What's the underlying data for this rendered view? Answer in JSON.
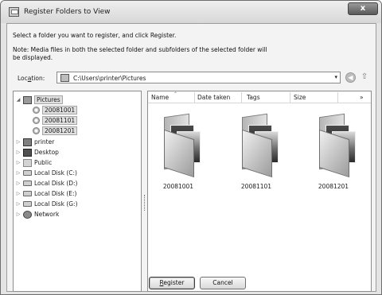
{
  "window": {
    "title": "Register Folders to View",
    "close_glyph": "x"
  },
  "instructions": "Select a folder you want to register, and click Register.",
  "note": "Note: Media files in both the selected folder and subfolders of the selected folder will be displayed.",
  "location": {
    "label_prefix": "Loc",
    "label_hotkey": "a",
    "label_suffix": "tion:",
    "path": "C:\\Users\\printer\\Pictures",
    "dropdown_glyph": "▾",
    "back_glyph": "◀",
    "up_glyph": "⇧"
  },
  "tree": {
    "items": [
      {
        "label": "Pictures",
        "icon": "pictures-folder-icon",
        "expanded": true
      },
      {
        "label": "20081001",
        "icon": "subfolder-icon"
      },
      {
        "label": "20081101",
        "icon": "subfolder-icon"
      },
      {
        "label": "20081201",
        "icon": "subfolder-icon"
      },
      {
        "label": "printer",
        "icon": "user-folder-icon"
      },
      {
        "label": "Desktop",
        "icon": "desktop-icon"
      },
      {
        "label": "Public",
        "icon": "folder-icon"
      },
      {
        "label": "Local Disk (C:)",
        "icon": "disk-icon"
      },
      {
        "label": "Local Disk (D:)",
        "icon": "disk-icon"
      },
      {
        "label": "Local Disk (E:)",
        "icon": "disk-icon"
      },
      {
        "label": "Local Disk (G:)",
        "icon": "disk-icon"
      },
      {
        "label": "Network",
        "icon": "network-icon"
      }
    ]
  },
  "list": {
    "columns": [
      "Name",
      "Date taken",
      "Tags",
      "Size"
    ],
    "more_glyph": "»",
    "folders": [
      "20081001",
      "20081101",
      "20081201"
    ]
  },
  "buttons": {
    "register_hotkey": "R",
    "register_rest": "egister",
    "cancel": "Cancel"
  }
}
